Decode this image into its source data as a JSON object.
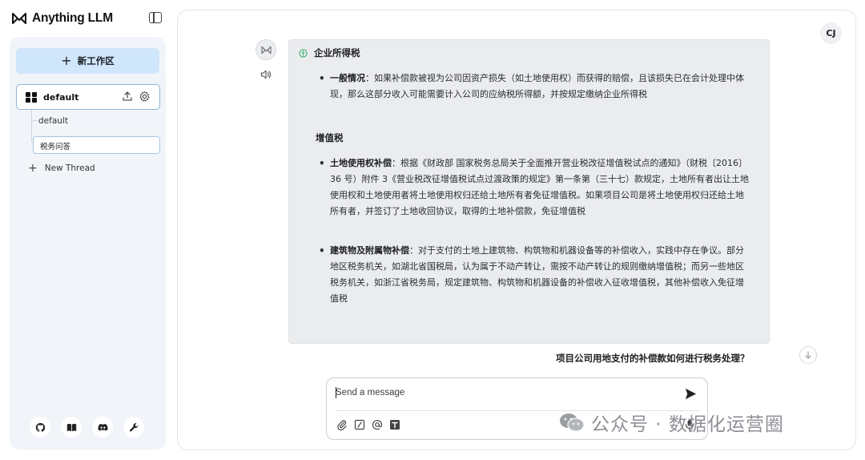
{
  "app": {
    "brand_name": "Anything LLM"
  },
  "sidebar": {
    "new_workspace_label": "新工作区",
    "workspace": {
      "name": "default"
    },
    "threads": [
      {
        "label": "default"
      },
      {
        "label": "税务问答"
      }
    ],
    "new_thread_label": "New Thread",
    "footer_icons": [
      "github-icon",
      "book-icon",
      "discord-icon",
      "wrench-icon"
    ]
  },
  "header": {
    "user_initials": "CJ"
  },
  "chat": {
    "response": {
      "title": "企业所得税",
      "general_label": "一般情况",
      "general_text": "：如果补偿款被视为公司因资产损失（如土地使用权）而获得的赔偿，且该损失已在会计处理中体现，那么这部分收入可能需要计入公司的应纳税所得额，并按规定缴纳企业所得税",
      "vat_title": "增值税",
      "land_label": "土地使用权补偿",
      "land_text": "：根据《财政部 国家税务总局关于全面推开营业税改征增值税试点的通知》（财税〔2016〕36 号）附件 3《营业税改征增值税试点过渡政策的规定》第一条第（三十七）款规定，土地所有者出让土地使用权和土地使用者将土地使用权归还给土地所有者免征增值税。如果项目公司是将土地使用权归还给土地所有者，并签订了土地收回协议，取得的土地补偿款，免征增值税",
      "building_label": "建筑物及附属物补偿",
      "building_text": "：对于支付的土地上建筑物、构筑物和机器设备等的补偿收入，实践中存在争议。部分地区税务机关，如湖北省国税局，认为属于不动产转让，需按不动产转让的规则缴纳增值税；而另一些地区税务机关，如浙江省税务局，规定建筑物、构筑物和机器设备的补偿收入征收增值税，其他补偿收入免征增值税"
    },
    "user_question": "项目公司用地支付的补偿款如何进行税务处理？"
  },
  "composer": {
    "placeholder": "Send a message"
  },
  "watermark": {
    "text": "公众号 · 数据化运营圈"
  },
  "colors": {
    "accent_button": "#cfe6fb",
    "sidebar_bg": "#f1f4f9",
    "bubble_bg": "#ebecee",
    "active_border": "#8fb7d9"
  }
}
